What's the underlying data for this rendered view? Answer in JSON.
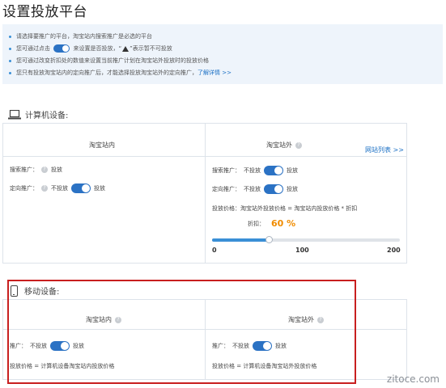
{
  "page_title": "设置投放平台",
  "tips": {
    "line1": "请选择要推广的平台，淘宝站内搜索推广是必选的平台",
    "line2_prefix": "您可通过点击",
    "line2_mid": "来设置是否投放，“",
    "line2_suffix": "”表示暂不可投放",
    "line3": "您可通过改变折扣处的数值来设置当前推广计划在淘宝站外投放时的投放价格",
    "line4_prefix": "您只有投放淘宝站内的定向推广后，才能选择投放淘宝站外的定向推广，",
    "line4_link": "了解详情 >>"
  },
  "computer": {
    "section_label": "计算机设备:",
    "inside": {
      "title": "淘宝站内",
      "search_label": "搜索推广：",
      "search_value": "投放",
      "targeted_label": "定向推广：",
      "targeted_off": "不投放",
      "targeted_on": "投放"
    },
    "outside": {
      "title": "淘宝站外",
      "site_list_link": "网站列表 >>",
      "search_label": "搜索推广：",
      "search_off": "不投放",
      "search_on": "投放",
      "targeted_label": "定向推广：",
      "targeted_off": "不投放",
      "targeted_on": "投放",
      "price_text": "投放价格：淘宝站外投放价格 = 淘宝站内投放价格 * 折扣",
      "discount_label": "折扣：",
      "discount_value": "60 %",
      "slider": {
        "min": "0",
        "mid": "100",
        "max": "200",
        "value": 60,
        "range_max": 200
      }
    }
  },
  "mobile": {
    "section_label": "移动设备:",
    "inside": {
      "title": "淘宝站内",
      "promo_label": "推广：",
      "promo_off": "不投放",
      "promo_on": "投放",
      "price_text": "投放价格 =  计算机设备淘宝站内投放价格"
    },
    "outside": {
      "title": "淘宝站外",
      "promo_label": "推广：",
      "promo_off": "不投放",
      "promo_on": "投放",
      "price_text": "投放价格 =  计算机设备淘宝站外投放价格"
    }
  },
  "watermark": "zitoce.com",
  "colors": {
    "accent": "#2b72c4",
    "discount": "#f08c00",
    "highlight": "#c81f1f",
    "tips_bg": "#eef4fb"
  }
}
